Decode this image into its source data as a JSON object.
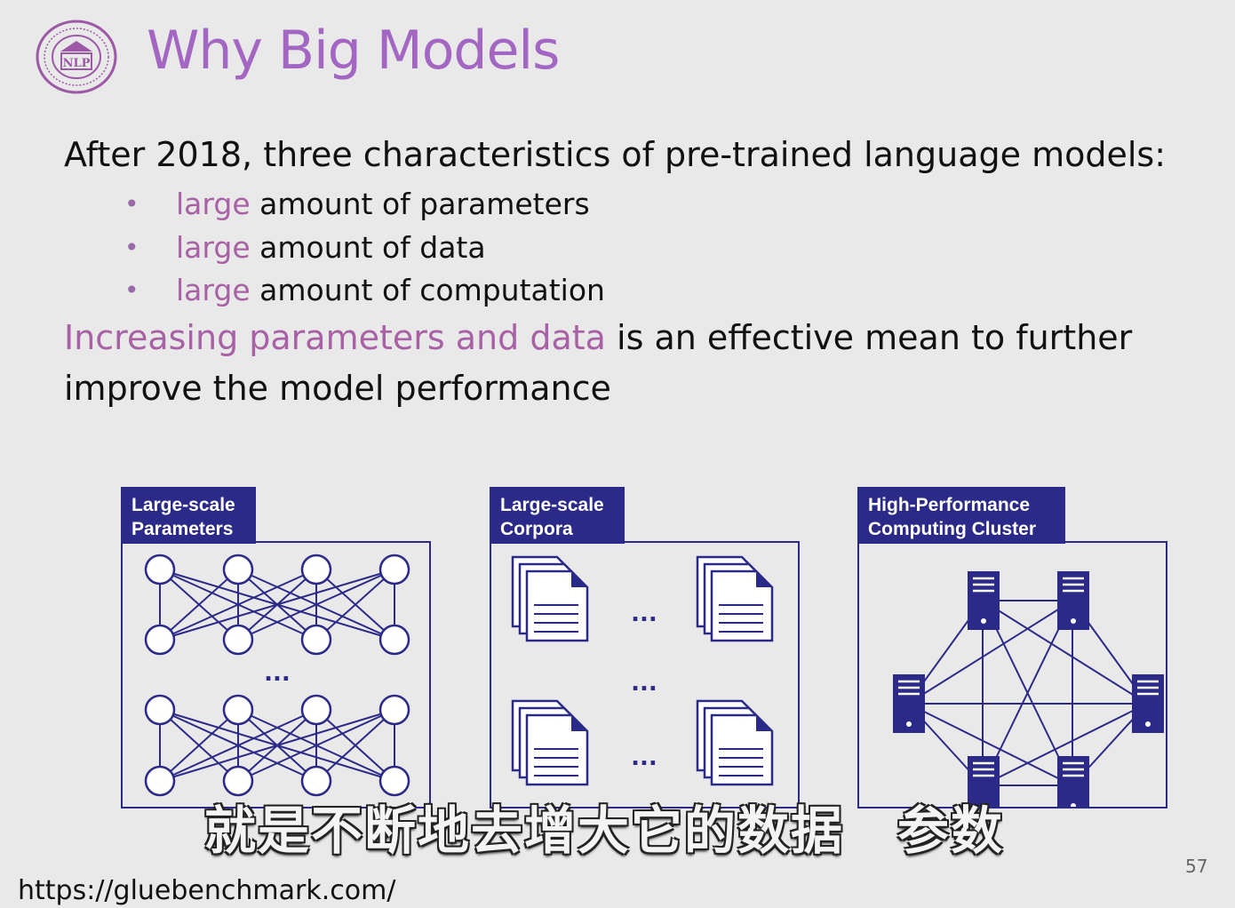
{
  "slide": {
    "title": "Why Big Models",
    "intro": "After 2018, three characteristics of pre-trained language models:",
    "bullets": [
      {
        "highlight": "large",
        "rest": " amount of parameters"
      },
      {
        "highlight": "large",
        "rest": " amount of data"
      },
      {
        "highlight": "large",
        "rest": " amount of computation"
      }
    ],
    "paragraph": {
      "highlight": "Increasing parameters and data",
      "rest": " is an effective mean to further improve the model performance"
    },
    "logo_text": "NLP",
    "panels": [
      {
        "label_line1": "Large-scale",
        "label_line2": "Parameters"
      },
      {
        "label_line1": "Large-scale",
        "label_line2": "Corpora"
      },
      {
        "label_line1": "High-Performance",
        "label_line2": "Computing Cluster"
      }
    ],
    "ellipsis": "...",
    "page_number": "57",
    "source_url": "https://gluebenchmark.com/"
  },
  "video": {
    "subtitle": "就是不断地去增大它的数据　参数"
  },
  "colors": {
    "title": "#a366c2",
    "accent": "#a861a5",
    "diagram": "#2b2a88",
    "background": "#e9e9e9"
  },
  "icons": [
    "university-seal-icon",
    "neural-network-icon",
    "document-stack-icon",
    "server-icon"
  ]
}
